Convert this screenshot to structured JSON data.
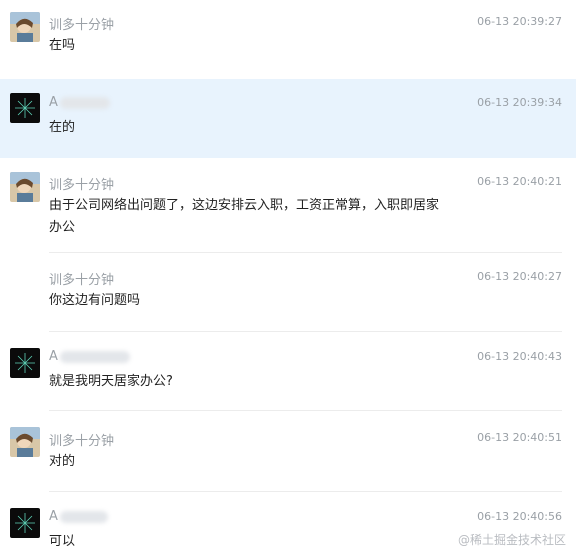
{
  "messages": [
    {
      "sender": "训多十分钟",
      "time": "06-13 20:39:27",
      "text": "在吗",
      "avatar": "user-photo-avatar"
    },
    {
      "sender": "A",
      "time": "06-13 20:39:34",
      "text": "在的",
      "avatar": "dark-firework-avatar"
    },
    {
      "sender": "训多十分钟",
      "time": "06-13 20:40:21",
      "text": "由于公司网络出问题了，这边安排云入职，工资正常算，入职即居家办公",
      "avatar": "user-photo-avatar"
    },
    {
      "sender": "训多十分钟",
      "time": "06-13 20:40:27",
      "text": "你这边有问题吗"
    },
    {
      "sender": "A",
      "time": "06-13 20:40:43",
      "text": "就是我明天居家办公?",
      "avatar": "dark-firework-avatar"
    },
    {
      "sender": "训多十分钟",
      "time": "06-13 20:40:51",
      "text": "对的",
      "avatar": "user-photo-avatar"
    },
    {
      "sender": "A",
      "time": "06-13 20:40:56",
      "text": "可以",
      "avatar": "dark-firework-avatar"
    }
  ],
  "watermark": "@稀土掘金技术社区",
  "colors": {
    "highlight": "#e8f3fd",
    "meta_text": "#9aa0a6",
    "body_text": "#222222"
  }
}
